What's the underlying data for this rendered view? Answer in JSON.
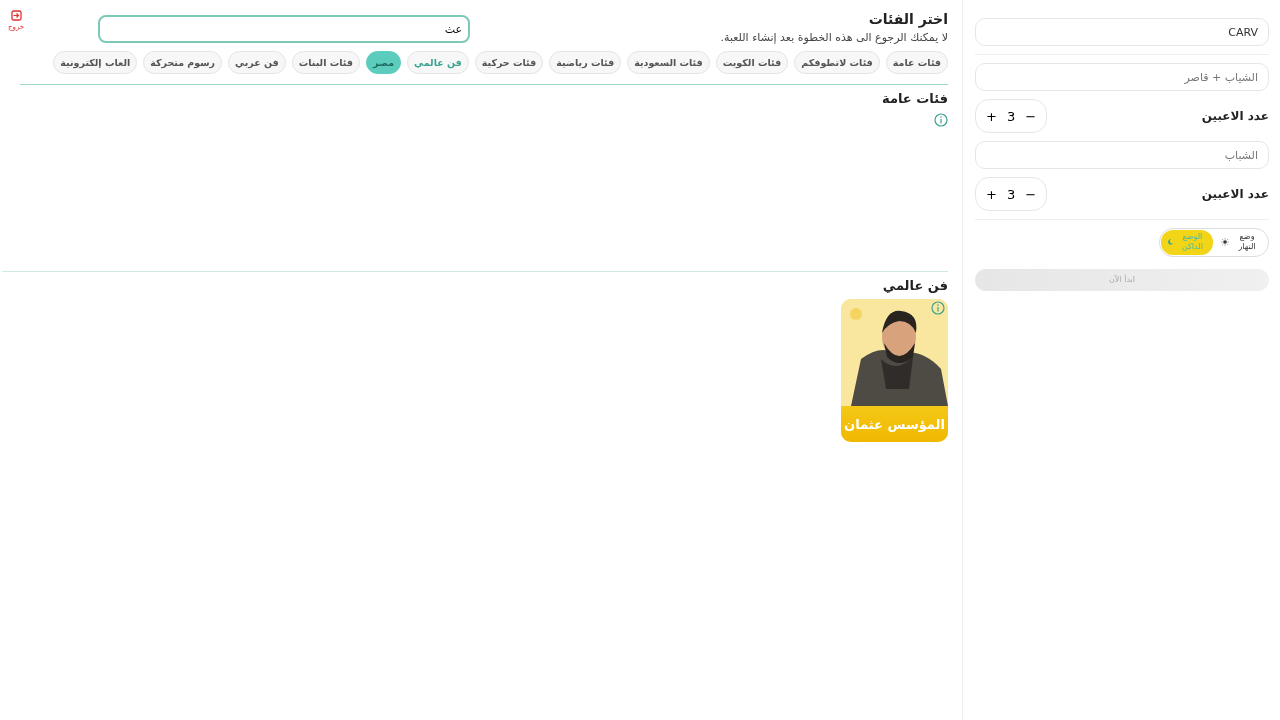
{
  "exit": {
    "label": "خروج"
  },
  "search": {
    "value": "عث"
  },
  "header": {
    "title": "اختر الفئات",
    "subtitle": "لا يمكنك الرجوع الى هذه الخطوة بعد إنشاء اللعبة."
  },
  "chips": [
    {
      "label": "فئات عامة",
      "selected": false,
      "highlighted": false
    },
    {
      "label": "فئات لاتطوفكم",
      "selected": false,
      "highlighted": false
    },
    {
      "label": "فئات الكويت",
      "selected": false,
      "highlighted": false
    },
    {
      "label": "فئات السعودية",
      "selected": false,
      "highlighted": false
    },
    {
      "label": "فئات رياضية",
      "selected": false,
      "highlighted": false
    },
    {
      "label": "فئات حركية",
      "selected": false,
      "highlighted": false
    },
    {
      "label": "فن عالمي",
      "selected": false,
      "highlighted": true
    },
    {
      "label": "مصر",
      "selected": true,
      "highlighted": false
    },
    {
      "label": "فئات البنات",
      "selected": false,
      "highlighted": false
    },
    {
      "label": "فن عربي",
      "selected": false,
      "highlighted": false
    },
    {
      "label": "رسوم متحركة",
      "selected": false,
      "highlighted": false
    },
    {
      "label": "العاب إلكترونية",
      "selected": false,
      "highlighted": false
    }
  ],
  "sections": [
    {
      "title": "فئات عامة",
      "info": true
    },
    {
      "title": "فن عالمي",
      "cards": [
        {
          "title": "المؤسس عثمان",
          "kind": "picture"
        }
      ]
    }
  ],
  "sidebar": {
    "game_name": "CARV",
    "teams": [
      {
        "name": "الشياب + قاصر",
        "players_label": "عدد الاعبين",
        "players": "3",
        "minus": "−",
        "plus": "+"
      },
      {
        "name": "الشباب",
        "players_label": "عدد الاعبين",
        "players": "3",
        "minus": "−",
        "plus": "+"
      }
    ],
    "modes": [
      {
        "label": "وضع النهار",
        "selected": false,
        "kind": "sun"
      },
      {
        "label": "الوضع الداكن",
        "selected": true,
        "kind": "moon"
      }
    ],
    "start": {
      "label": "ابدأ الآن",
      "disabled": true
    }
  }
}
